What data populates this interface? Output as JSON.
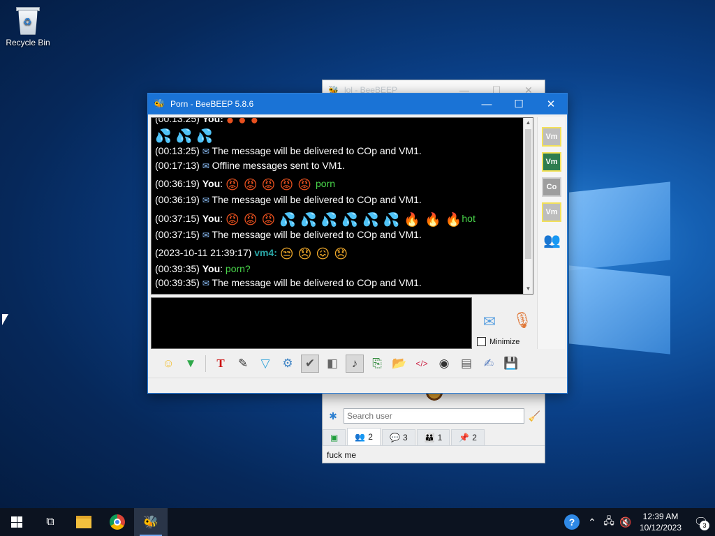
{
  "desktop": {
    "recycle_bin_label": "Recycle Bin"
  },
  "back_window": {
    "title": "lol - BeeBEEP",
    "search_placeholder": "Search user",
    "tabs": [
      {
        "icon": "users-icon",
        "count": "2"
      },
      {
        "icon": "chat-icon",
        "count": "3"
      },
      {
        "icon": "groups-icon",
        "count": "1"
      },
      {
        "icon": "files-icon",
        "count": "2"
      }
    ],
    "status_text": "fuck me"
  },
  "main_window": {
    "title": "Porn - BeeBEEP 5.8.6",
    "messages": {
      "m1_ts": "(00:13:25)",
      "m1_text": "The message will be delivered to COp and VM1.",
      "m2_ts": "(00:17:13)",
      "m2_text": "Offline messages sent to VM1.",
      "m3_ts": "(00:36:19)",
      "m3_you": "You",
      "m3_tail": "porn",
      "m4_ts": "(00:36:19)",
      "m4_text": "The message will be delivered to COp and VM1.",
      "m5_ts": "(00:37:15)",
      "m5_you": "You",
      "m5_tail": "hot",
      "m6_ts": "(00:37:15)",
      "m6_text": "The message will be delivered to COp and VM1.",
      "m7_ts": "(2023-10-11 21:39:17)",
      "m7_user": "vm4:",
      "m8_ts": "(00:39:35)",
      "m8_you": "You",
      "m8_tail": "porn?",
      "m9_ts": "(00:39:35)",
      "m9_text": "The message will be delivered to COp and VM1.",
      "top_partial_ts": "(00:13:25)",
      "top_partial_you": "You:"
    },
    "minimize_label": "Minimize",
    "members": [
      "Vm",
      "Vm",
      "Co",
      "Vm"
    ]
  },
  "taskbar": {
    "time": "12:39 AM",
    "date": "10/12/2023",
    "notifications_count": "3"
  }
}
